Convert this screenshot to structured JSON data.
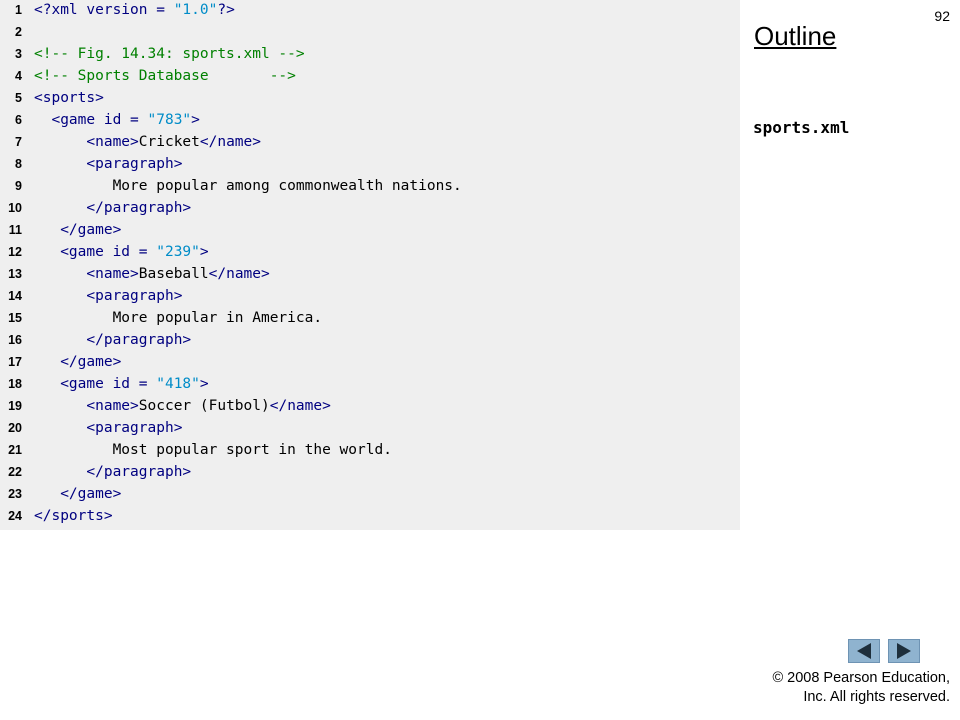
{
  "page_number": "92",
  "outline_title": "Outline",
  "file_name": "sports.xml",
  "nav": {
    "prev_icon": "triangle-left-icon",
    "next_icon": "triangle-right-icon",
    "button_color": "#8fb3cf"
  },
  "copyright": {
    "line1": "© 2008 Pearson Education,",
    "line2": "Inc.  All rights reserved."
  },
  "code": {
    "lines": [
      {
        "n": "1",
        "parts": [
          [
            "tag",
            "<?xml version = "
          ],
          [
            "val",
            "\"1.0\""
          ],
          [
            "tag",
            "?>"
          ]
        ]
      },
      {
        "n": "2",
        "parts": []
      },
      {
        "n": "3",
        "parts": [
          [
            "comment",
            "<!-- Fig. 14.34: sports.xml -->"
          ]
        ]
      },
      {
        "n": "4",
        "parts": [
          [
            "comment",
            "<!-- Sports Database       -->"
          ]
        ]
      },
      {
        "n": "5",
        "parts": [
          [
            "tag",
            "<sports>"
          ]
        ]
      },
      {
        "n": "6",
        "parts": [
          [
            "text",
            "  "
          ],
          [
            "tag",
            "<game id = "
          ],
          [
            "val",
            "\"783\""
          ],
          [
            "tag",
            ">"
          ]
        ]
      },
      {
        "n": "7",
        "parts": [
          [
            "text",
            "      "
          ],
          [
            "tag",
            "<name>"
          ],
          [
            "text",
            "Cricket"
          ],
          [
            "tag",
            "</name>"
          ]
        ]
      },
      {
        "n": "8",
        "parts": [
          [
            "text",
            "      "
          ],
          [
            "tag",
            "<paragraph>"
          ]
        ]
      },
      {
        "n": "9",
        "parts": [
          [
            "text",
            "         More popular among commonwealth nations."
          ]
        ]
      },
      {
        "n": "10",
        "parts": [
          [
            "text",
            "      "
          ],
          [
            "tag",
            "</paragraph>"
          ]
        ]
      },
      {
        "n": "11",
        "parts": [
          [
            "text",
            "   "
          ],
          [
            "tag",
            "</game>"
          ]
        ]
      },
      {
        "n": "12",
        "parts": [
          [
            "text",
            "   "
          ],
          [
            "tag",
            "<game id = "
          ],
          [
            "val",
            "\"239\""
          ],
          [
            "tag",
            ">"
          ]
        ]
      },
      {
        "n": "13",
        "parts": [
          [
            "text",
            "      "
          ],
          [
            "tag",
            "<name>"
          ],
          [
            "text",
            "Baseball"
          ],
          [
            "tag",
            "</name>"
          ]
        ]
      },
      {
        "n": "14",
        "parts": [
          [
            "text",
            "      "
          ],
          [
            "tag",
            "<paragraph>"
          ]
        ]
      },
      {
        "n": "15",
        "parts": [
          [
            "text",
            "         More popular in America."
          ]
        ]
      },
      {
        "n": "16",
        "parts": [
          [
            "text",
            "      "
          ],
          [
            "tag",
            "</paragraph>"
          ]
        ]
      },
      {
        "n": "17",
        "parts": [
          [
            "text",
            "   "
          ],
          [
            "tag",
            "</game>"
          ]
        ]
      },
      {
        "n": "18",
        "parts": [
          [
            "text",
            "   "
          ],
          [
            "tag",
            "<game id = "
          ],
          [
            "val",
            "\"418\""
          ],
          [
            "tag",
            ">"
          ]
        ]
      },
      {
        "n": "19",
        "parts": [
          [
            "text",
            "      "
          ],
          [
            "tag",
            "<name>"
          ],
          [
            "text",
            "Soccer (Futbol)"
          ],
          [
            "tag",
            "</name>"
          ]
        ]
      },
      {
        "n": "20",
        "parts": [
          [
            "text",
            "      "
          ],
          [
            "tag",
            "<paragraph>"
          ]
        ]
      },
      {
        "n": "21",
        "parts": [
          [
            "text",
            "         Most popular sport in the world."
          ]
        ]
      },
      {
        "n": "22",
        "parts": [
          [
            "text",
            "      "
          ],
          [
            "tag",
            "</paragraph>"
          ]
        ]
      },
      {
        "n": "23",
        "parts": [
          [
            "text",
            "   "
          ],
          [
            "tag",
            "</game>"
          ]
        ]
      },
      {
        "n": "24",
        "parts": [
          [
            "tag",
            "</sports>"
          ]
        ]
      }
    ]
  }
}
